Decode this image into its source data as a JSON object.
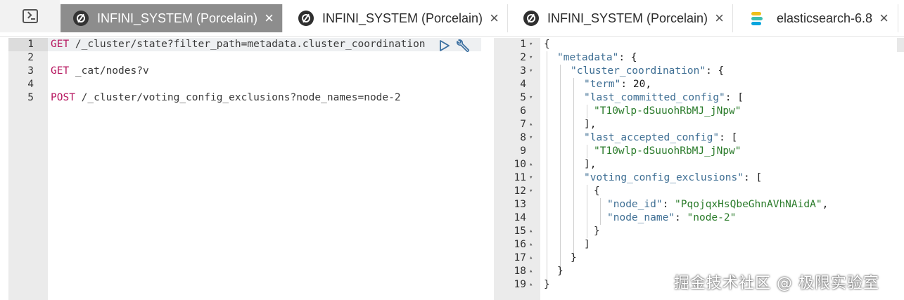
{
  "tabs": [
    {
      "label": "INFINI_SYSTEM (Porcelain)",
      "active": true,
      "icon": "infini-logo-icon"
    },
    {
      "label": "INFINI_SYSTEM (Porcelain)",
      "active": false,
      "icon": "infini-logo-icon"
    },
    {
      "label": "INFINI_SYSTEM (Porcelain)",
      "active": false,
      "icon": "infini-logo-icon"
    },
    {
      "label": "elasticsearch-6.8",
      "active": false,
      "icon": "elasticsearch-logo-icon"
    }
  ],
  "close_glyph": "×",
  "request_editor": {
    "lines": [
      {
        "num": "1",
        "method": "GET",
        "path": " /_cluster/state?filter_path=metadata.cluster_coordination"
      },
      {
        "num": "2",
        "method": "",
        "path": ""
      },
      {
        "num": "3",
        "method": "GET",
        "path": " _cat/nodes?v"
      },
      {
        "num": "4",
        "method": "",
        "path": ""
      },
      {
        "num": "5",
        "method": "POST",
        "path": " /_cluster/voting_config_exclusions?node_names=node-2"
      }
    ]
  },
  "response_editor": {
    "lines": [
      {
        "num": "1",
        "fold": "▾",
        "text": "{"
      },
      {
        "num": "2",
        "fold": "▾",
        "key": "\"metadata\"",
        "rest": ": {"
      },
      {
        "num": "3",
        "fold": "▾",
        "key": "\"cluster_coordination\"",
        "rest": ": {"
      },
      {
        "num": "4",
        "fold": "",
        "key": "\"term\"",
        "rest": ": ",
        "number": "20",
        "tail": ","
      },
      {
        "num": "5",
        "fold": "▾",
        "key": "\"last_committed_config\"",
        "rest": ": ["
      },
      {
        "num": "6",
        "fold": "",
        "string": "\"T10wlp-dSuuohRbMJ_jNpw\""
      },
      {
        "num": "7",
        "fold": "▴",
        "text": "],"
      },
      {
        "num": "8",
        "fold": "▾",
        "key": "\"last_accepted_config\"",
        "rest": ": ["
      },
      {
        "num": "9",
        "fold": "",
        "string": "\"T10wlp-dSuuohRbMJ_jNpw\""
      },
      {
        "num": "10",
        "fold": "▴",
        "text": "],"
      },
      {
        "num": "11",
        "fold": "▾",
        "key": "\"voting_config_exclusions\"",
        "rest": ": ["
      },
      {
        "num": "12",
        "fold": "▾",
        "text": "{"
      },
      {
        "num": "13",
        "fold": "",
        "key": "\"node_id\"",
        "rest": ": ",
        "string": "\"PqojqxHsQbeGhnAVhNAidA\"",
        "tail": ","
      },
      {
        "num": "14",
        "fold": "",
        "key": "\"node_name\"",
        "rest": ": ",
        "string": "\"node-2\""
      },
      {
        "num": "15",
        "fold": "▴",
        "text": "}"
      },
      {
        "num": "16",
        "fold": "▴",
        "text": "]"
      },
      {
        "num": "17",
        "fold": "▴",
        "text": "}"
      },
      {
        "num": "18",
        "fold": "▴",
        "text": "}"
      },
      {
        "num": "19",
        "fold": "▴",
        "text": "}"
      }
    ]
  },
  "watermark": "掘金技术社区 @ 极限实验室"
}
